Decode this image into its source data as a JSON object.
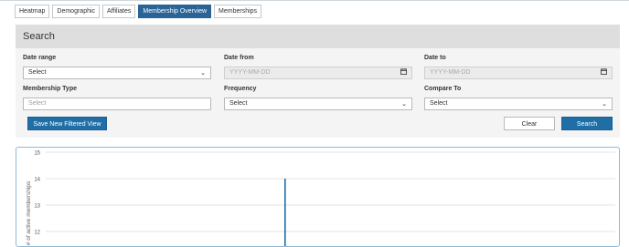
{
  "tabs": [
    {
      "label": "Heatmap",
      "active": false
    },
    {
      "label": "Demographic",
      "active": false
    },
    {
      "label": "Affiliates",
      "active": false
    },
    {
      "label": "Membership Overview",
      "active": true
    },
    {
      "label": "Memberships",
      "active": false
    }
  ],
  "search": {
    "title": "Search",
    "date_range": {
      "label": "Date range",
      "value": "Select"
    },
    "date_from": {
      "label": "Date from",
      "placeholder": "YYYY-MM-DD"
    },
    "date_to": {
      "label": "Date to",
      "placeholder": "YYYY-MM-DD"
    },
    "membership_type": {
      "label": "Membership Type",
      "placeholder": "Select"
    },
    "frequency": {
      "label": "Frequency",
      "value": "Select"
    },
    "compare_to": {
      "label": "Compare To",
      "value": "Select"
    },
    "save_label": "Save New Filtered View",
    "clear_label": "Clear",
    "search_label": "Search"
  },
  "colors": {
    "accent": "#1f6ea6",
    "active_tab": "#2a6496",
    "chart_border": "#8fb8d6"
  },
  "chart_data": {
    "type": "bar",
    "ylabel": "# of active memberships",
    "y_ticks": [
      "15",
      "14",
      "13",
      "12"
    ],
    "ylim": [
      11.5,
      15
    ],
    "values": [
      14
    ],
    "grid": true
  }
}
